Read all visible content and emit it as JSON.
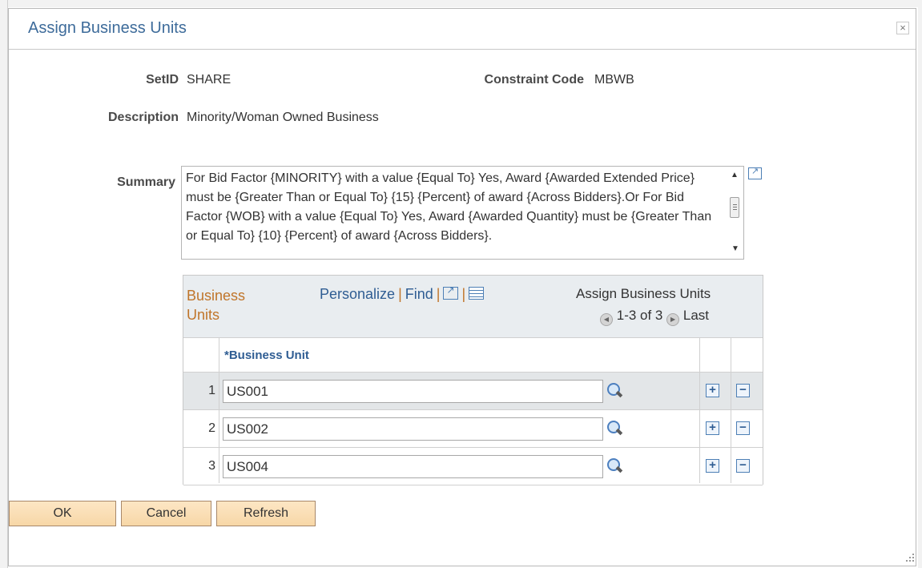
{
  "dialog": {
    "title": "Assign Business Units",
    "close_glyph": "×"
  },
  "fields": {
    "setid_label": "SetID",
    "setid_value": "SHARE",
    "constraint_label": "Constraint Code",
    "constraint_value": "MBWB",
    "description_label": "Description",
    "description_value": "Minority/Woman Owned Business",
    "summary_label": "Summary",
    "summary_text": "For Bid Factor {MINORITY} with a value {Equal To} Yes, Award {Awarded Extended Price} must be {Greater Than or Equal To} {15} {Percent} of award {Across Bidders}.Or For Bid Factor {WOB} with a value {Equal To} Yes, Award {Awarded Quantity} must be {Greater Than or Equal To} {10} {Percent} of award {Across Bidders}."
  },
  "grid": {
    "title": "Business Units",
    "personalize_link": "Personalize",
    "find_link": "Find",
    "separator": "|",
    "caption": "Assign Business Units",
    "range_text": "1-3 of 3",
    "last_link": "Last",
    "column_header": "*Business Unit",
    "rows": [
      {
        "num": "1",
        "value": "US001"
      },
      {
        "num": "2",
        "value": "US002"
      },
      {
        "num": "3",
        "value": "US004"
      }
    ],
    "add_glyph": "+",
    "remove_glyph": "−"
  },
  "buttons": {
    "ok": "OK",
    "cancel": "Cancel",
    "refresh": "Refresh"
  },
  "colors": {
    "title_blue": "#3d6b9a",
    "link_blue": "#2f5d93",
    "grid_title_orange": "#c0752a",
    "button_fill": "#f7d7a7"
  },
  "icons": {
    "close": "close-icon",
    "expand": "expand-icon",
    "zoom": "zoom-grid-icon",
    "download": "download-excel-icon",
    "lookup": "lookup-magnifier-icon",
    "prev": "previous-arrow-icon",
    "next": "next-arrow-icon"
  }
}
